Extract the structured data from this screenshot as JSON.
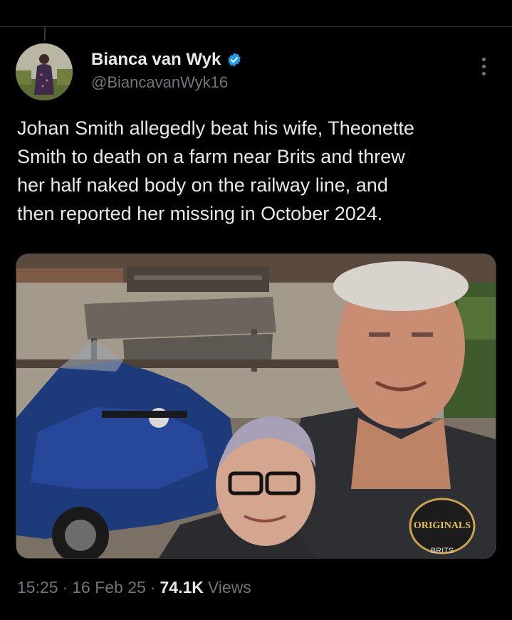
{
  "author": {
    "display_name": "Bianca van Wyk",
    "handle": "@BiancavanWyk16",
    "verified": true
  },
  "tweet": {
    "text": "Johan Smith allegedly beat his wife, Theonette\nSmith to death on a farm  near Brits and threw\nher half naked body on the railway line, and\nthen reported her missing in October 2024."
  },
  "media": {
    "patches": [
      "ORIGINALS",
      "BRITS"
    ]
  },
  "meta": {
    "time": "15:25",
    "separator": "·",
    "date": "16 Feb 25",
    "views_count": "74.1K",
    "views_label": "Views"
  },
  "colors": {
    "background": "#000000",
    "text": "#e7e9ea",
    "muted": "#71767b",
    "verified": "#1d9bf0"
  }
}
